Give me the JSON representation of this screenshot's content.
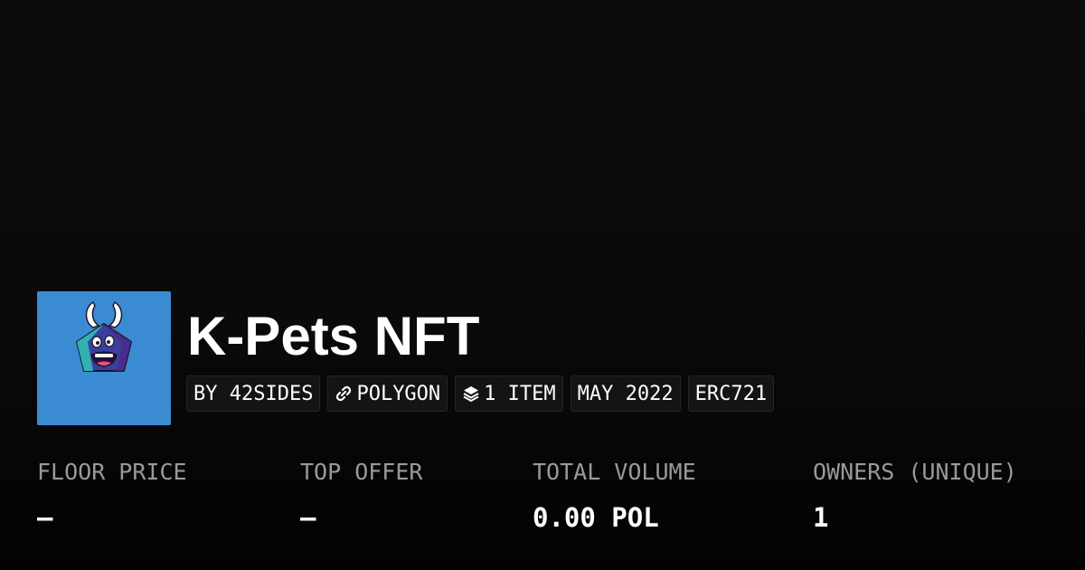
{
  "collection": {
    "title": "K-Pets NFT",
    "avatar_icon": "k-pets-monster-avatar",
    "avatar_bg_color": "#3b8bd2"
  },
  "tags": {
    "creator": "BY 42SIDES",
    "chain": "POLYGON",
    "chain_icon": "polygon-link-icon",
    "items": "1 ITEM",
    "items_icon": "layers-icon",
    "date": "MAY 2022",
    "standard": "ERC721"
  },
  "stats": {
    "floor_price": {
      "label": "FLOOR PRICE",
      "value": "–"
    },
    "top_offer": {
      "label": "TOP OFFER",
      "value": "–"
    },
    "total_volume": {
      "label": "TOTAL VOLUME",
      "value": "0.00 POL"
    },
    "owners": {
      "label": "OWNERS (UNIQUE)",
      "value": "1"
    }
  }
}
